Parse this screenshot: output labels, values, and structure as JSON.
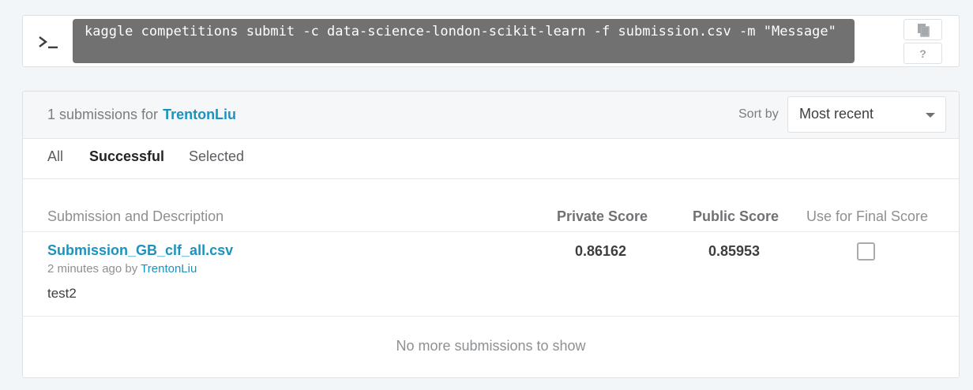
{
  "api": {
    "command": "kaggle competitions submit -c data-science-london-scikit-learn -f submission.csv -m \"Message\"",
    "help_label": "?"
  },
  "submissions": {
    "count_text": "1 submissions for",
    "user": "TrentonLiu",
    "sort_label": "Sort by",
    "sort_value": "Most recent",
    "tabs": [
      {
        "label": "All",
        "active": false
      },
      {
        "label": "Successful",
        "active": true
      },
      {
        "label": "Selected",
        "active": false
      }
    ],
    "columns": {
      "description": "Submission and Description",
      "private": "Private Score",
      "public": "Public Score",
      "final": "Use for Final Score"
    },
    "rows": [
      {
        "name": "Submission_GB_clf_all.csv",
        "time": "2 minutes ago by",
        "by": "TrentonLiu",
        "description": "test2",
        "private_score": "0.86162",
        "public_score": "0.85953",
        "use_for_final": false
      }
    ],
    "footer": "No more submissions to show"
  },
  "colors": {
    "link": "#1b93bf",
    "command_bg": "#717171",
    "page_bg": "#f3f6f8"
  }
}
